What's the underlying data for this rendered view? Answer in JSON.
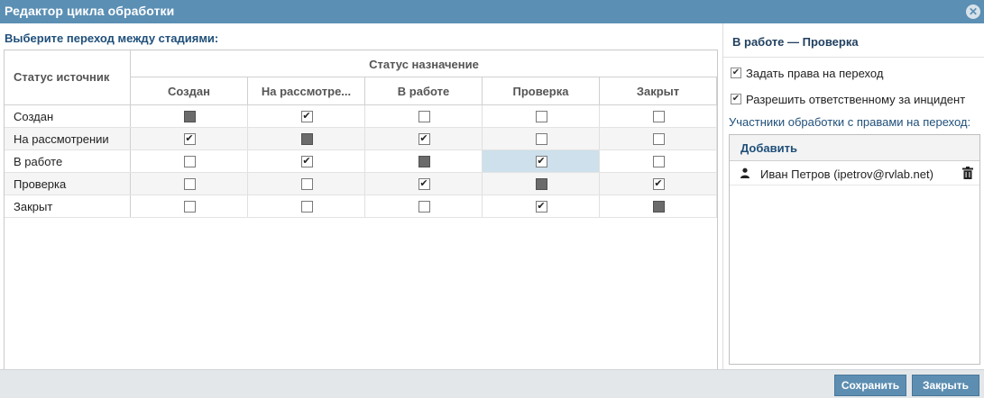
{
  "window": {
    "title": "Редактор цикла обработки"
  },
  "left": {
    "section_label": "Выберите переход между стадиями:",
    "source_header": "Статус источник",
    "target_header": "Статус назначение",
    "columns": [
      "Создан",
      "На рассмотре...",
      "В работе",
      "Проверка",
      "Закрыт"
    ],
    "rows": [
      {
        "label": "Создан",
        "cells": [
          "blocked",
          "checked",
          "unchecked",
          "unchecked",
          "unchecked"
        ]
      },
      {
        "label": "На рассмотрении",
        "cells": [
          "checked",
          "blocked",
          "checked",
          "unchecked",
          "unchecked"
        ]
      },
      {
        "label": "В работе",
        "cells": [
          "unchecked",
          "checked",
          "blocked",
          "checked",
          "unchecked"
        ]
      },
      {
        "label": "Проверка",
        "cells": [
          "unchecked",
          "unchecked",
          "checked",
          "blocked",
          "checked"
        ]
      },
      {
        "label": "Закрыт",
        "cells": [
          "unchecked",
          "unchecked",
          "unchecked",
          "checked",
          "blocked"
        ]
      }
    ],
    "selected_cell": {
      "row": 2,
      "col": 3
    }
  },
  "right": {
    "title": "В работе — Проверка",
    "options": [
      {
        "label": "Задать права на переход",
        "checked": true
      },
      {
        "label": "Разрешить ответственному за инцидент",
        "checked": true
      }
    ],
    "participants_label": "Участники обработки с правами на переход:",
    "add_label": "Добавить",
    "participants": [
      {
        "name": "Иван Петров (ipetrov@rvlab.net)"
      }
    ]
  },
  "footer": {
    "save_label": "Сохранить",
    "close_label": "Закрыть"
  },
  "colors": {
    "titlebar": "#5b8fb4",
    "button": "#5d8eb2",
    "highlight": "#cde0ec",
    "blocked": "#6b6b6b"
  },
  "icons": {
    "close": "close-icon",
    "person": "person-icon",
    "trash": "trash-icon"
  }
}
